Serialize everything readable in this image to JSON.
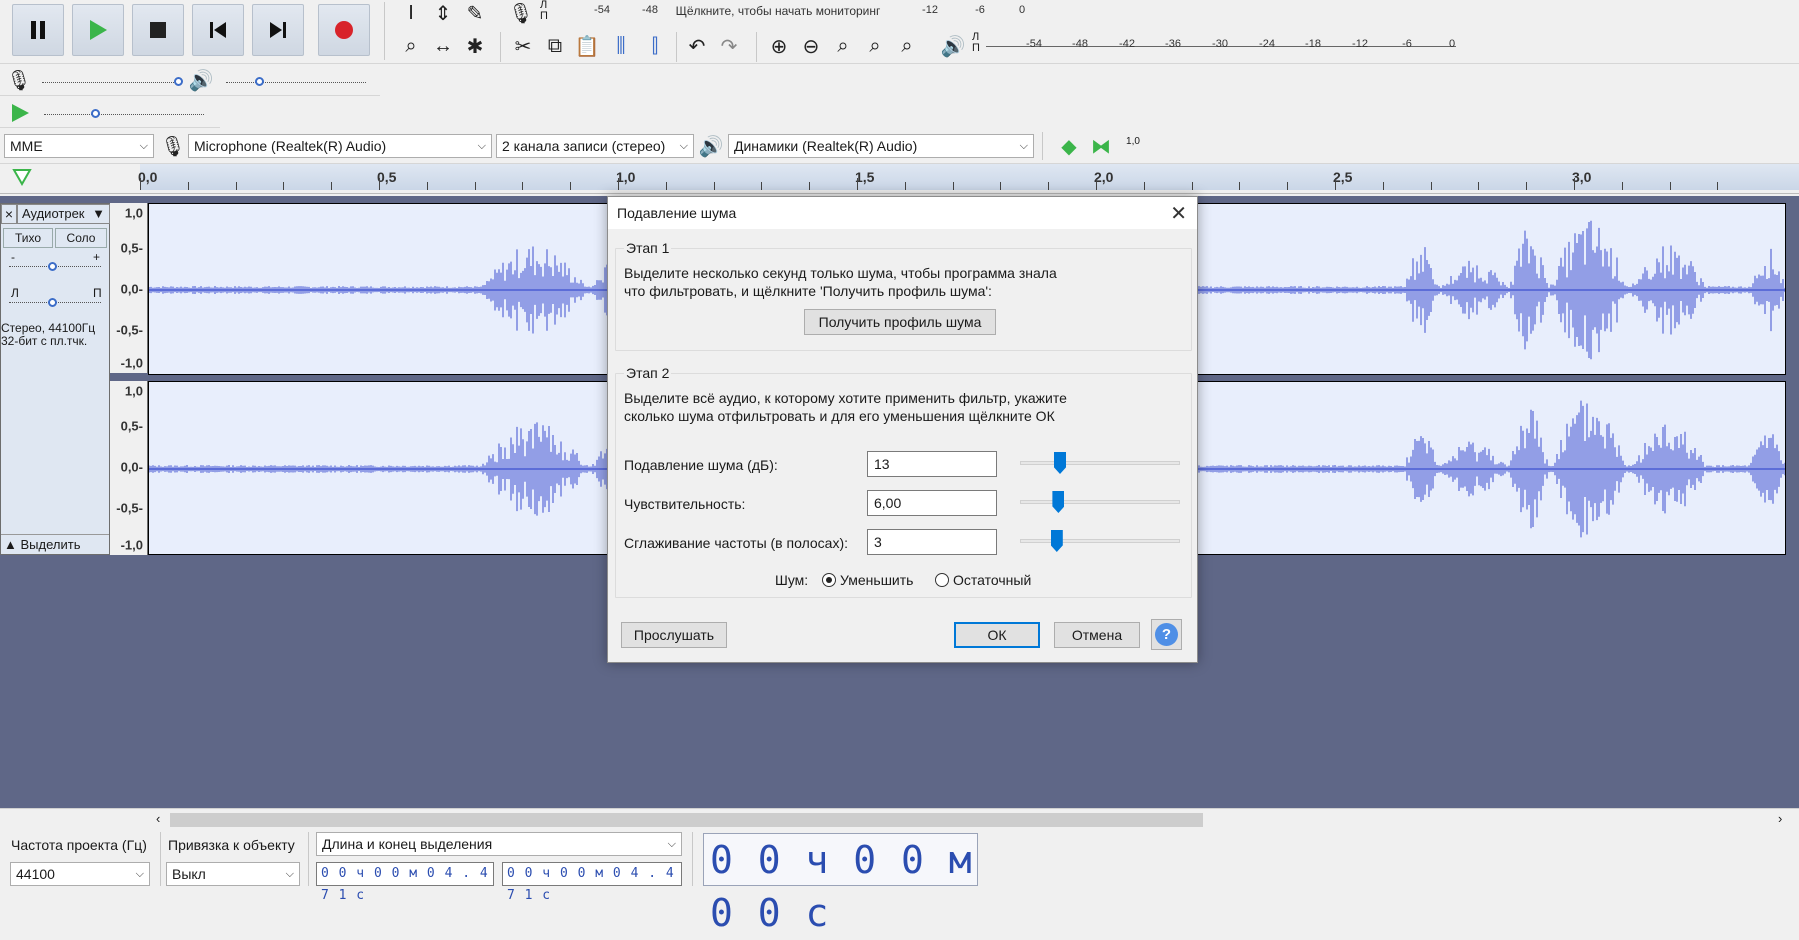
{
  "meters": {
    "rec_hint": "Щёлкните, чтобы начать мониторинг",
    "rec_scale": [
      "-54",
      "-48",
      "-12",
      "-6",
      "0"
    ],
    "play_scale": [
      "-54",
      "-48",
      "-42",
      "-36",
      "-30",
      "-24",
      "-18",
      "-12",
      "-6",
      "0"
    ],
    "lr_label": "Л\nП"
  },
  "device": {
    "host": "MME",
    "mic": "Microphone (Realtek(R) Audio)",
    "channels": "2  канала записи (стерео)",
    "speakers": "Динамики (Realtek(R) Audio)",
    "speed_label": "1,0"
  },
  "ruler": {
    "labels": [
      "0,0",
      "0,5",
      "1,0",
      "1,5",
      "2,0",
      "2,5",
      "3,0"
    ]
  },
  "track": {
    "name": "Аудиотрек",
    "mute": "Тихо",
    "solo": "Соло",
    "gain_minus": "-",
    "gain_plus": "+",
    "pan_l": "Л",
    "pan_r": "П",
    "info_line1": "Стерео, 44100Гц",
    "info_line2": "32-бит с пл.тчк.",
    "select": "Выделить",
    "close": "×",
    "collapse": "▲",
    "scale": [
      "1,0",
      "0,5-",
      "0,0-",
      "-0,5-",
      "-1,0"
    ]
  },
  "dialog": {
    "title": "Подавление шума",
    "step1_legend": "Этап 1",
    "step1_text1": "Выделите несколько секунд только шума, чтобы программа знала",
    "step1_text2": "что фильтровать, и щёлкните 'Получить профиль шума':",
    "get_profile": "Получить профиль шума",
    "step2_legend": "Этап 2",
    "step2_text1": "Выделите всё аудио, к которому хотите применить фильтр, укажите",
    "step2_text2": "сколько шума отфильтровать и для его уменьшения щёлкните ОК",
    "reduction_label": "Подавление шума (дБ):",
    "reduction_value": "13",
    "reduction_level": 0.25,
    "sensitivity_label": "Чувствительность:",
    "sensitivity_value": "6,00",
    "sensitivity_level": 0.24,
    "smoothing_label": "Сглаживание частоты (в полосах):",
    "smoothing_value": "3",
    "smoothing_level": 0.23,
    "noise_label": "Шум:",
    "reduce_option": "Уменьшить",
    "residual_option": "Остаточный",
    "preview": "Прослушать",
    "ok": "ОК",
    "cancel": "Отмена",
    "help": "?"
  },
  "bottom": {
    "rate_label": "Частота проекта (Гц)",
    "rate_value": "44100",
    "snap_label": "Привязка к объекту",
    "snap_value": "Выкл",
    "sel_mode": "Длина и конец выделения",
    "sel_start": "0 0 ч 0 0 м 0 4 . 4 7 1 с",
    "sel_end": "0 0 ч 0 0 м 0 4 . 4 7 1 с",
    "time": "0 0 ч 0 0 м 0 0 с"
  }
}
